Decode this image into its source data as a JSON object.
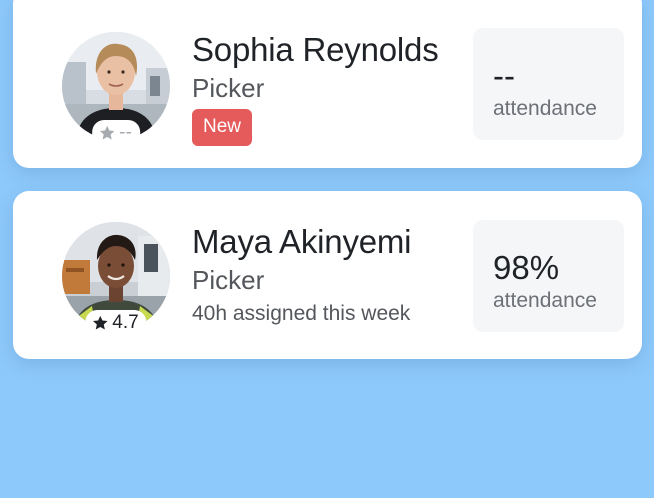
{
  "workers": [
    {
      "name": "Sophia Reynolds",
      "role": "Picker",
      "rating": "--",
      "badge": "New",
      "attendance_value": "--",
      "attendance_label": "attendance",
      "attendance_known": false
    },
    {
      "name": "Maya Akinyemi",
      "role": "Picker",
      "rating": "4.7",
      "assigned": "40h assigned this week",
      "attendance_value": "98%",
      "attendance_percent": 98,
      "attendance_label": "attendance",
      "attendance_known": true
    }
  ],
  "icons": {
    "rating": "star-icon"
  },
  "colors": {
    "background": "#8ec9fb",
    "card": "#ffffff",
    "badge_new": "#e55a5a",
    "star_empty": "#a7aaaf",
    "star_filled": "#1f2227",
    "attendance_box": "#f5f6f8"
  }
}
